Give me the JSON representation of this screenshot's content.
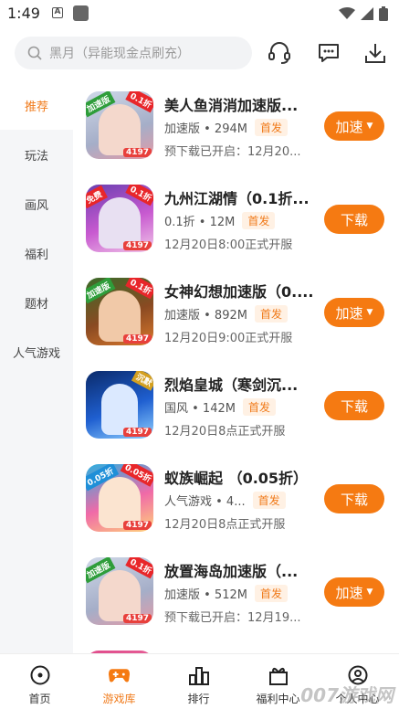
{
  "status_bar": {
    "time": "1:49",
    "a_glyph": "A"
  },
  "search": {
    "placeholder": "黑月（异能现金点刷充）"
  },
  "sidebar": {
    "items": [
      {
        "label": "推荐",
        "active": true
      },
      {
        "label": "玩法",
        "active": false
      },
      {
        "label": "画风",
        "active": false
      },
      {
        "label": "福利",
        "active": false
      },
      {
        "label": "题材",
        "active": false
      },
      {
        "label": "人气游戏",
        "active": false
      }
    ]
  },
  "games": [
    {
      "title": "美人鱼消消加速版...",
      "meta": "加速版 • 294M",
      "tag": "首发",
      "sub": "预下载已开启：12月20...",
      "button": "加速",
      "caret": "▼",
      "ribbon_left": "加速版",
      "ribbon_right": "0.1折",
      "badge": "4197"
    },
    {
      "title": "九州江湖情（0.1折...",
      "meta": "0.1折 • 12M",
      "tag": "首发",
      "sub": "12月20日8:00正式开服",
      "button": "下载",
      "caret": "",
      "ribbon_left": "免费",
      "ribbon_right": "0.1折",
      "badge": "4197"
    },
    {
      "title": "女神幻想加速版（0....",
      "meta": "加速版 • 892M",
      "tag": "首发",
      "sub": "12月20日9:00正式开服",
      "button": "加速",
      "caret": "▼",
      "ribbon_left": "加速版",
      "ribbon_right": "0.1折",
      "badge": "4197"
    },
    {
      "title": "烈焰皇城（寒剑沉...",
      "meta": "国风 • 142M",
      "tag": "首发",
      "sub": "12月20日8点正式开服",
      "button": "下载",
      "caret": "",
      "ribbon_left": "",
      "ribbon_right": "沉默",
      "badge": "4197"
    },
    {
      "title": "蚁族崛起 （0.05折）",
      "meta": "人气游戏 • 4...",
      "tag": "首发",
      "sub": "12月20日8点正式开服",
      "button": "下载",
      "caret": "",
      "ribbon_left": "0.05折",
      "ribbon_right": "0.05折",
      "badge": "4197"
    },
    {
      "title": "放置海岛加速版（...",
      "meta": "加速版 • 512M",
      "tag": "首发",
      "sub": "预下载已开启：12月19...",
      "button": "加速",
      "caret": "▼",
      "ribbon_left": "加速版",
      "ribbon_right": "0.1折",
      "badge": "4197"
    }
  ],
  "tabbar": {
    "tabs": [
      {
        "label": "首页",
        "icon": "home-icon",
        "active": false
      },
      {
        "label": "游戏库",
        "icon": "gamepad-icon",
        "active": true
      },
      {
        "label": "排行",
        "icon": "ranking-icon",
        "active": false
      },
      {
        "label": "福利中心",
        "icon": "gift-icon",
        "active": false
      },
      {
        "label": "个人中心",
        "icon": "user-icon",
        "active": false
      }
    ]
  },
  "watermark": "007游戏网",
  "colors": {
    "accent": "#f57a12",
    "tag_bg": "#fff1e4",
    "sidebar_bg": "#f5f6f8"
  }
}
